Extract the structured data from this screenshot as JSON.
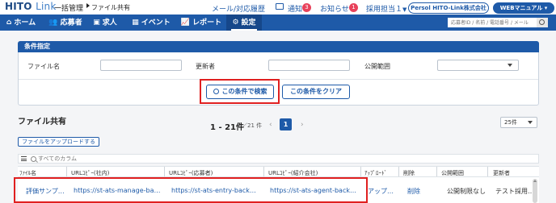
{
  "header": {
    "logo_main": "HITO",
    "logo_link": "Link",
    "ikkatsu": "一括管理",
    "breadcrumb": "ファイル共有",
    "mail_history": "メール/対応履歴",
    "notice": "通知",
    "notice_count": "3",
    "oshirase": "お知らせ",
    "oshirase_count": "1",
    "recruiter": "採用担当１",
    "company": "Persol HITO-Link株式会社",
    "manual": "WEBマニュアル"
  },
  "nav": {
    "home": "ホーム",
    "applicants": "応募者",
    "jobs": "求人",
    "events": "イベント",
    "reports": "レポート",
    "settings": "設定",
    "search_placeholder": "応募者ID / 名前 / 電話番号 / メール"
  },
  "conditions": {
    "title": "条件指定",
    "file_name_label": "ファイル名",
    "updater_label": "更新者",
    "scope_label": "公開範囲",
    "search_button": "この条件で検索",
    "clear_button": "この条件をクリア"
  },
  "fileshare": {
    "title": "ファイル共有",
    "range": "1 - 21件",
    "total": "／21 件",
    "prev": "‹",
    "current_page": "1",
    "next": "›",
    "per_page": "25件",
    "upload_button": "ファイルをアップロードする",
    "column_search_placeholder": "すべてのカラム"
  },
  "table": {
    "columns": [
      "ﾌｧｲﾙ名",
      "URLｺﾋﾟｰ(社内)",
      "URLｺﾋﾟｰ(応募者)",
      "URLｺﾋﾟｰ(紹介会社)",
      "ｱｯﾌﾟﾛｰﾄﾞ",
      "削除",
      "公開範囲",
      "更新者"
    ],
    "rows": [
      {
        "file_name": "評価サンプ…",
        "url_internal": "https://st-ats-manage-ba…",
        "url_applicant": "https://st-ats-entry-back…",
        "url_agent": "https://st-ats-agent-back…",
        "upload": "アップ…",
        "delete": "削除",
        "scope": "公開制限なし",
        "updater": "テスト採用…"
      }
    ]
  },
  "colors": {
    "primary": "#1e5aa8",
    "highlight": "#e02020",
    "badge": "#e8425b"
  }
}
